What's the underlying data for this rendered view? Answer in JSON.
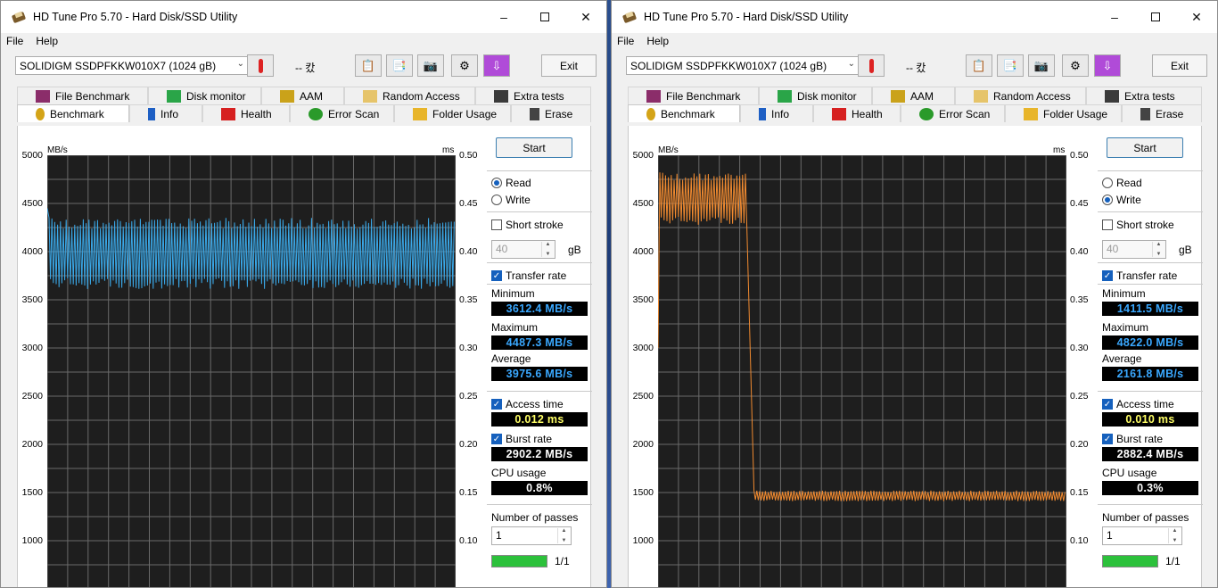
{
  "windows": [
    {
      "title": "HD Tune Pro 5.70 - Hard Disk/SSD Utility",
      "menu": [
        "File",
        "Help"
      ],
      "drive": "SOLIDIGM SSDPFKKW010X7 (1024 gB)",
      "temperature": "-- 캈",
      "exit_label": "Exit",
      "tabs_top": [
        "File Benchmark",
        "Disk monitor",
        "AAM",
        "Random Access",
        "Extra tests"
      ],
      "tabs_bottom": [
        "Benchmark",
        "Info",
        "Health",
        "Error Scan",
        "Folder Usage",
        "Erase"
      ],
      "active_tab": "Benchmark",
      "start_label": "Start",
      "read_label": "Read",
      "write_label": "Write",
      "mode": "read",
      "short_stroke_label": "Short stroke",
      "short_stroke_checked": false,
      "short_stroke_value": "40",
      "gb_label": "gB",
      "transfer_rate_label": "Transfer rate",
      "transfer_rate_checked": true,
      "minimum_label": "Minimum",
      "minimum": "3612.4 MB/s",
      "maximum_label": "Maximum",
      "maximum": "4487.3 MB/s",
      "average_label": "Average",
      "average": "3975.6 MB/s",
      "access_time_label": "Access time",
      "access_time_checked": true,
      "access_time": "0.012 ms",
      "burst_rate_label": "Burst rate",
      "burst_rate_checked": true,
      "burst_rate": "2902.2 MB/s",
      "cpu_usage_label": "CPU usage",
      "cpu_usage": "0.8%",
      "passes_label": "Number of passes",
      "passes_value": "1",
      "pass_progress_text": "1/1",
      "pass_progress": 1.0,
      "line_color": "#3aa8e8"
    },
    {
      "title": "HD Tune Pro 5.70 - Hard Disk/SSD Utility",
      "menu": [
        "File",
        "Help"
      ],
      "drive": "SOLIDIGM SSDPFKKW010X7 (1024 gB)",
      "temperature": "-- 캈",
      "exit_label": "Exit",
      "tabs_top": [
        "File Benchmark",
        "Disk monitor",
        "AAM",
        "Random Access",
        "Extra tests"
      ],
      "tabs_bottom": [
        "Benchmark",
        "Info",
        "Health",
        "Error Scan",
        "Folder Usage",
        "Erase"
      ],
      "active_tab": "Benchmark",
      "start_label": "Start",
      "read_label": "Read",
      "write_label": "Write",
      "mode": "write",
      "short_stroke_label": "Short stroke",
      "short_stroke_checked": false,
      "short_stroke_value": "40",
      "gb_label": "gB",
      "transfer_rate_label": "Transfer rate",
      "transfer_rate_checked": true,
      "minimum_label": "Minimum",
      "minimum": "1411.5 MB/s",
      "maximum_label": "Maximum",
      "maximum": "4822.0 MB/s",
      "average_label": "Average",
      "average": "2161.8 MB/s",
      "access_time_label": "Access time",
      "access_time_checked": true,
      "access_time": "0.010 ms",
      "burst_rate_label": "Burst rate",
      "burst_rate_checked": true,
      "burst_rate": "2882.4 MB/s",
      "cpu_usage_label": "CPU usage",
      "cpu_usage": "0.3%",
      "passes_label": "Number of passes",
      "passes_value": "1",
      "pass_progress_text": "1/1",
      "pass_progress": 1.0,
      "line_color": "#f08a30"
    }
  ],
  "chart_data": [
    {
      "type": "line",
      "title": "",
      "ylabel_left": "MB/s",
      "ylabel_right": "ms",
      "yticks_left": [
        "5000",
        "4500",
        "4000",
        "3500",
        "3000",
        "2500",
        "2000",
        "1500",
        "1000"
      ],
      "yticks_right": [
        "0.50",
        "0.45",
        "0.40",
        "0.35",
        "0.30",
        "0.25",
        "0.20",
        "0.15",
        "0.10"
      ],
      "ylim_left": [
        500,
        5000
      ],
      "xlim": [
        0,
        100
      ],
      "grid": true,
      "series": [
        {
          "segments": [
            {
              "x_from": 0,
              "x_to": 100,
              "low": 3612,
              "high": 4350,
              "oscillating": true
            }
          ],
          "start_value": 4450
        }
      ]
    },
    {
      "type": "line",
      "title": "",
      "ylabel_left": "MB/s",
      "ylabel_right": "ms",
      "yticks_left": [
        "5000",
        "4500",
        "4000",
        "3500",
        "3000",
        "2500",
        "2000",
        "1500",
        "1000"
      ],
      "yticks_right": [
        "0.50",
        "0.45",
        "0.40",
        "0.35",
        "0.30",
        "0.25",
        "0.20",
        "0.15",
        "0.10"
      ],
      "ylim_left": [
        500,
        5000
      ],
      "xlim": [
        0,
        100
      ],
      "grid": true,
      "series": [
        {
          "segments": [
            {
              "x_from": 0,
              "x_to": 21.5,
              "low": 4280,
              "high": 4822,
              "oscillating": true
            },
            {
              "x_from": 23.5,
              "x_to": 100,
              "low": 1411,
              "high": 1520,
              "oscillating": true
            }
          ],
          "start_value": 3000
        }
      ]
    }
  ]
}
